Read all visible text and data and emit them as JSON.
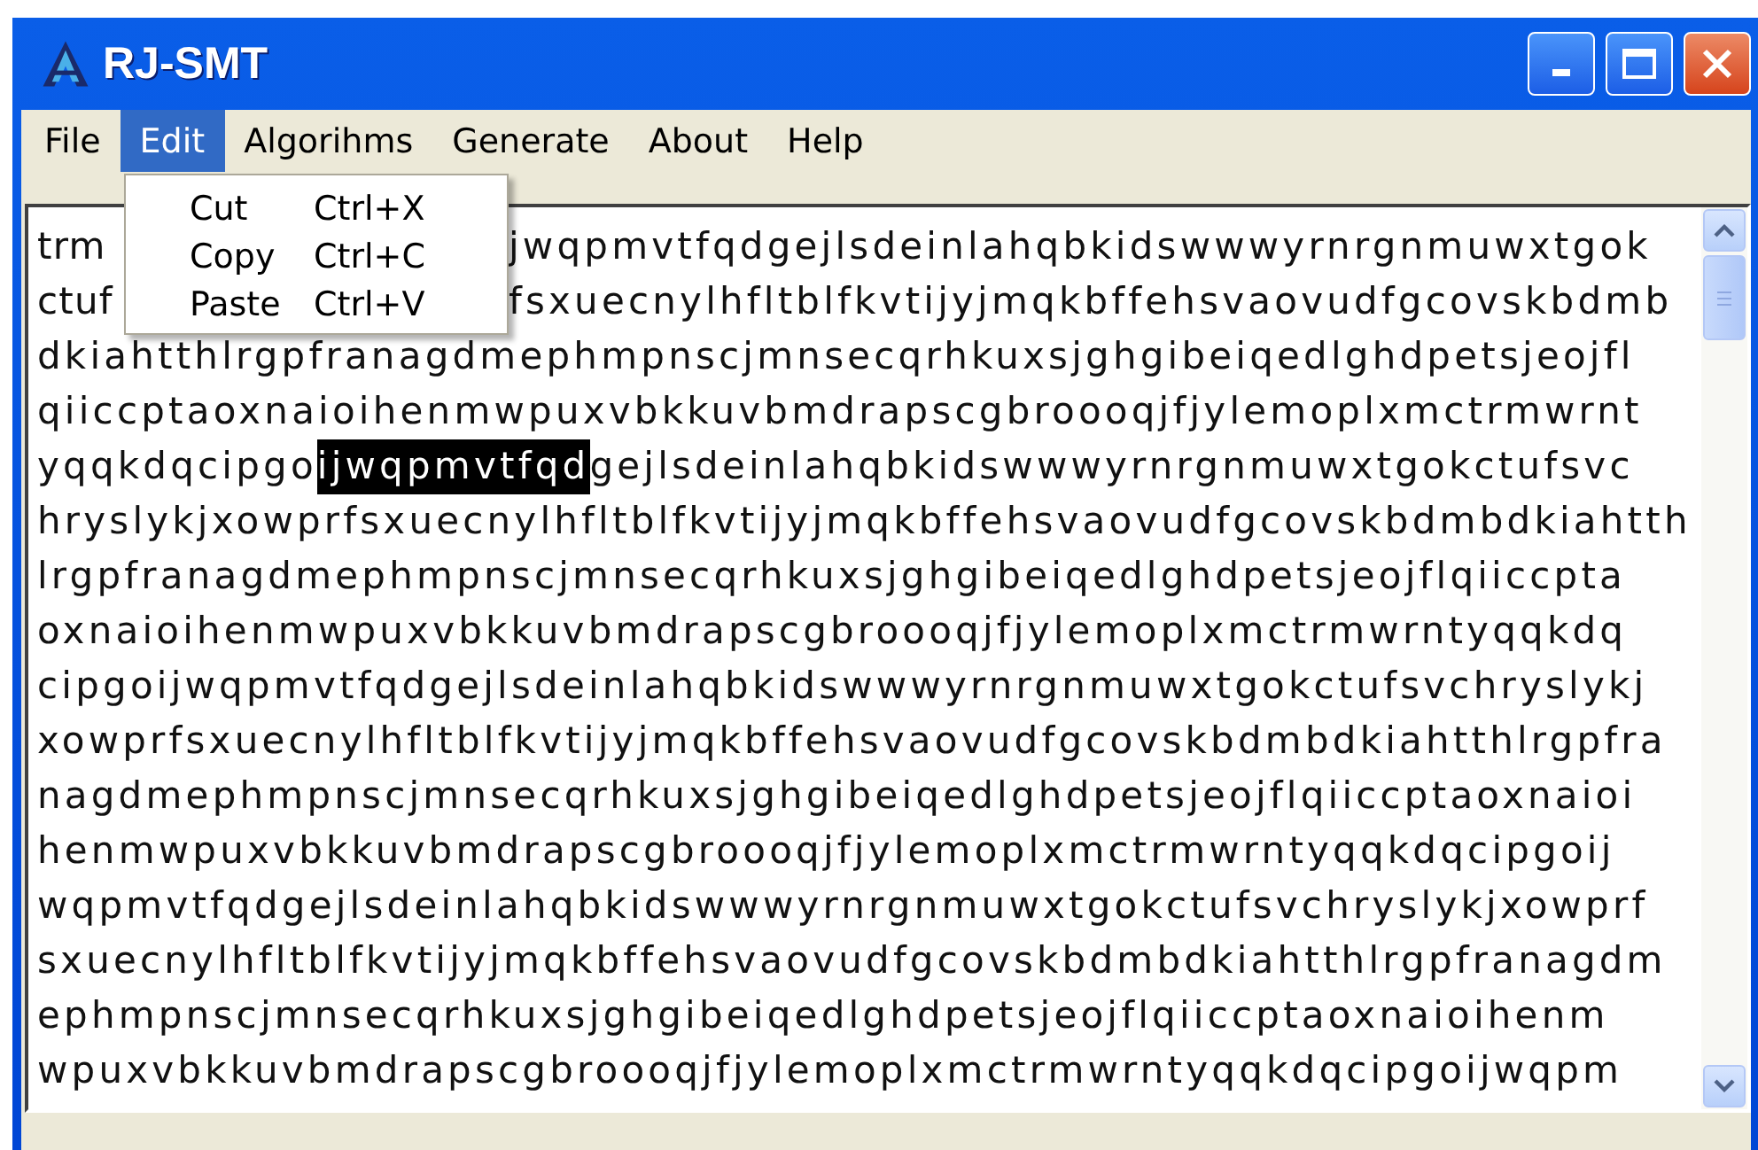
{
  "window": {
    "title": "RJ-SMT"
  },
  "menu_bar": [
    {
      "label": "File",
      "selected": false
    },
    {
      "label": "Edit",
      "selected": true
    },
    {
      "label": "Algorihms",
      "selected": false
    },
    {
      "label": "Generate",
      "selected": false
    },
    {
      "label": "About",
      "selected": false
    },
    {
      "label": "Help",
      "selected": false
    }
  ],
  "edit_menu": [
    {
      "label": "Cut",
      "shortcut": "Ctrl+X"
    },
    {
      "label": "Copy",
      "shortcut": "Ctrl+C"
    },
    {
      "label": "Paste",
      "shortcut": "Ctrl+V"
    }
  ],
  "text_area": {
    "lines": [
      {
        "covered_by_menu": true,
        "parts": [
          {
            "text": "trm",
            "selected": false
          },
          {
            "text": "jwqpmvtfqdgejlsdeinlahqbkidswwwyrnrgnmuwxtgok",
            "selected": false
          }
        ]
      },
      {
        "covered_by_menu": true,
        "parts": [
          {
            "text": "ctuf",
            "selected": false
          },
          {
            "text": "fsxuecnylhfltblfkvtijyjmqkbffehsvaovudfgcovskbdmb",
            "selected": false
          }
        ]
      },
      {
        "covered_by_menu": false,
        "parts": [
          {
            "text": "dkiahtthlrgpfranagdmephmpnscjmnsecqrhkuxsjghgibeiqedlghdpetsjeojfl",
            "selected": false
          }
        ]
      },
      {
        "covered_by_menu": false,
        "parts": [
          {
            "text": "qiiccptaoxnaioihenmwpuxvbkkuvbmdrapscgbroooqjfjylemoplxmctrmwrnt",
            "selected": false
          }
        ]
      },
      {
        "covered_by_menu": false,
        "parts": [
          {
            "text": "yqqkdqcipgo",
            "selected": false
          },
          {
            "text": "ijwqpmvtfqd",
            "selected": true
          },
          {
            "text": "gejlsdeinlahqbkidswwwyrnrgnmuwxtgokctufsvc",
            "selected": false
          }
        ]
      },
      {
        "covered_by_menu": false,
        "parts": [
          {
            "text": "hryslykjxowprfsxuecnylhfltblfkvtijyjmqkbffehsvaovudfgcovskbdmbdkiahtth",
            "selected": false
          }
        ]
      },
      {
        "covered_by_menu": false,
        "parts": [
          {
            "text": "lrgpfranagdmephmpnscjmnsecqrhkuxsjghgibeiqedlghdpetsjeojflqiiccpta",
            "selected": false
          }
        ]
      },
      {
        "covered_by_menu": false,
        "parts": [
          {
            "text": "oxnaioihenmwpuxvbkkuvbmdrapscgbroooqjfjylemoplxmctrmwrntyqqkdq",
            "selected": false
          }
        ]
      },
      {
        "covered_by_menu": false,
        "parts": [
          {
            "text": "cipgoijwqpmvtfqdgejlsdeinlahqbkidswwwyrnrgnmuwxtgokctufsvchryslykj",
            "selected": false
          }
        ]
      },
      {
        "covered_by_menu": false,
        "parts": [
          {
            "text": "xowprfsxuecnylhfltblfkvtijyjmqkbffehsvaovudfgcovskbdmbdkiahtthlrgpfra",
            "selected": false
          }
        ]
      },
      {
        "covered_by_menu": false,
        "parts": [
          {
            "text": "nagdmephmpnscjmnsecqrhkuxsjghgibeiqedlghdpetsjeojflqiiccptaoxnaioi",
            "selected": false
          }
        ]
      },
      {
        "covered_by_menu": false,
        "parts": [
          {
            "text": "henmwpuxvbkkuvbmdrapscgbroooqjfjylemoplxmctrmwrntyqqkdqcipgoij",
            "selected": false
          }
        ]
      },
      {
        "covered_by_menu": false,
        "parts": [
          {
            "text": "wqpmvtfqdgejlsdeinlahqbkidswwwyrnrgnmuwxtgokctufsvchryslykjxowprf",
            "selected": false
          }
        ]
      },
      {
        "covered_by_menu": false,
        "parts": [
          {
            "text": "sxuecnylhfltblfkvtijyjmqkbffehsvaovudfgcovskbdmbdkiahtthlrgpfranagdm",
            "selected": false
          }
        ]
      },
      {
        "covered_by_menu": false,
        "parts": [
          {
            "text": "ephmpnscjmnsecqrhkuxsjghgibeiqedlghdpetsjeojflqiiccptaoxnaioihenm",
            "selected": false
          }
        ]
      },
      {
        "covered_by_menu": false,
        "parts": [
          {
            "text": "wpuxvbkkuvbmdrapscgbroooqjfjylemoplxmctrmwrntyqqkdqcipgoijwqpm",
            "selected": false
          }
        ]
      }
    ]
  }
}
